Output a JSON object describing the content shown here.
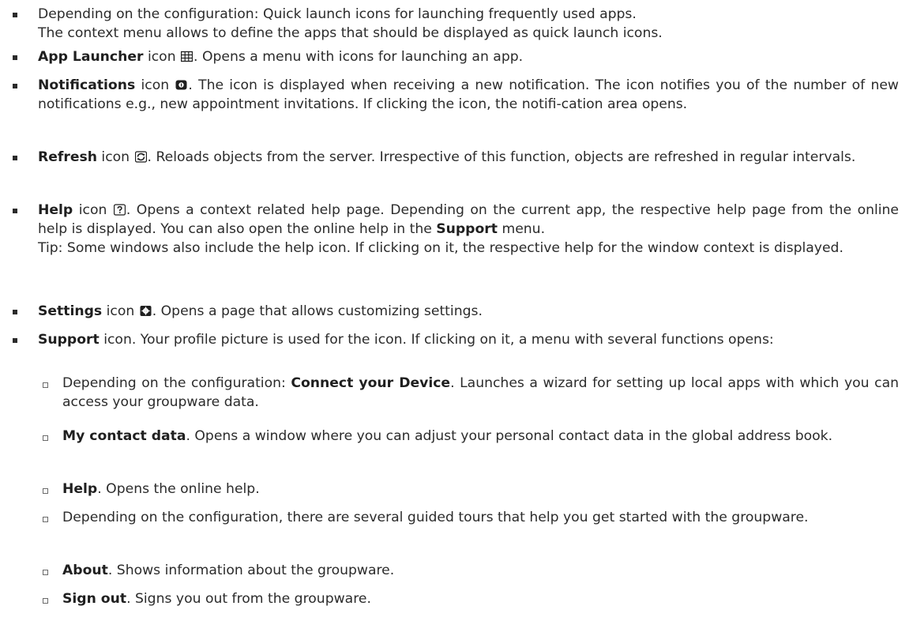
{
  "items": [
    {
      "lines": [
        "Depending on the configuration: Quick launch icons for launching frequently used apps.",
        "The context menu allows to define the apps that should be displayed as quick launch icons."
      ]
    },
    {
      "title": "App Launcher",
      "pre": " icon ",
      "icon": "app-launcher-grid-icon",
      "post": ". Opens a menu with icons for launching an app."
    },
    {
      "title": "Notifications",
      "pre": " icon ",
      "icon": "notifications-badge-icon",
      "post": ". The icon is displayed when receiving a new notification. The icon notifies you of the number of new notifications e.g., new appointment invitations. If clicking the icon, the notifi-cation area opens."
    },
    {
      "title": "Refresh",
      "pre": " icon ",
      "icon": "refresh-icon",
      "post": ". Reloads objects from the server. Irrespective of this function, objects are refreshed in regular intervals."
    },
    {
      "title": "Help",
      "pre": " icon ",
      "icon": "help-question-icon",
      "post": ". Opens a context related help page. Depending on the current app, the respective help page from the online help is displayed. You can also open the online help in the ",
      "bold2": "Support",
      "post2": " menu.",
      "tip": "Tip: Some windows also include the help icon. If clicking on it, the respective help for the window context is displayed."
    },
    {
      "title": "Settings",
      "pre": " icon ",
      "icon": "settings-gear-icon",
      "post": ". Opens a page that allows customizing settings."
    },
    {
      "title": "Support",
      "post": " icon. Your profile picture is used for the icon. If clicking on it, a menu with several functions opens:"
    }
  ],
  "subitems": [
    {
      "pre": "Depending on the configuration: ",
      "title": "Connect your Device",
      "post": ". Launches a wizard for setting up local apps with which you can access your groupware data."
    },
    {
      "title": "My contact data",
      "post": ". Opens a window where you can adjust your personal contact data in the global address book."
    },
    {
      "title": "Help",
      "post": ". Opens the online help."
    },
    {
      "text": "Depending on the configuration, there are several guided tours that help you get started with the groupware."
    },
    {
      "title": "About",
      "post": ". Shows information about the groupware."
    },
    {
      "title": "Sign out",
      "post": ". Signs you out from the groupware."
    }
  ]
}
